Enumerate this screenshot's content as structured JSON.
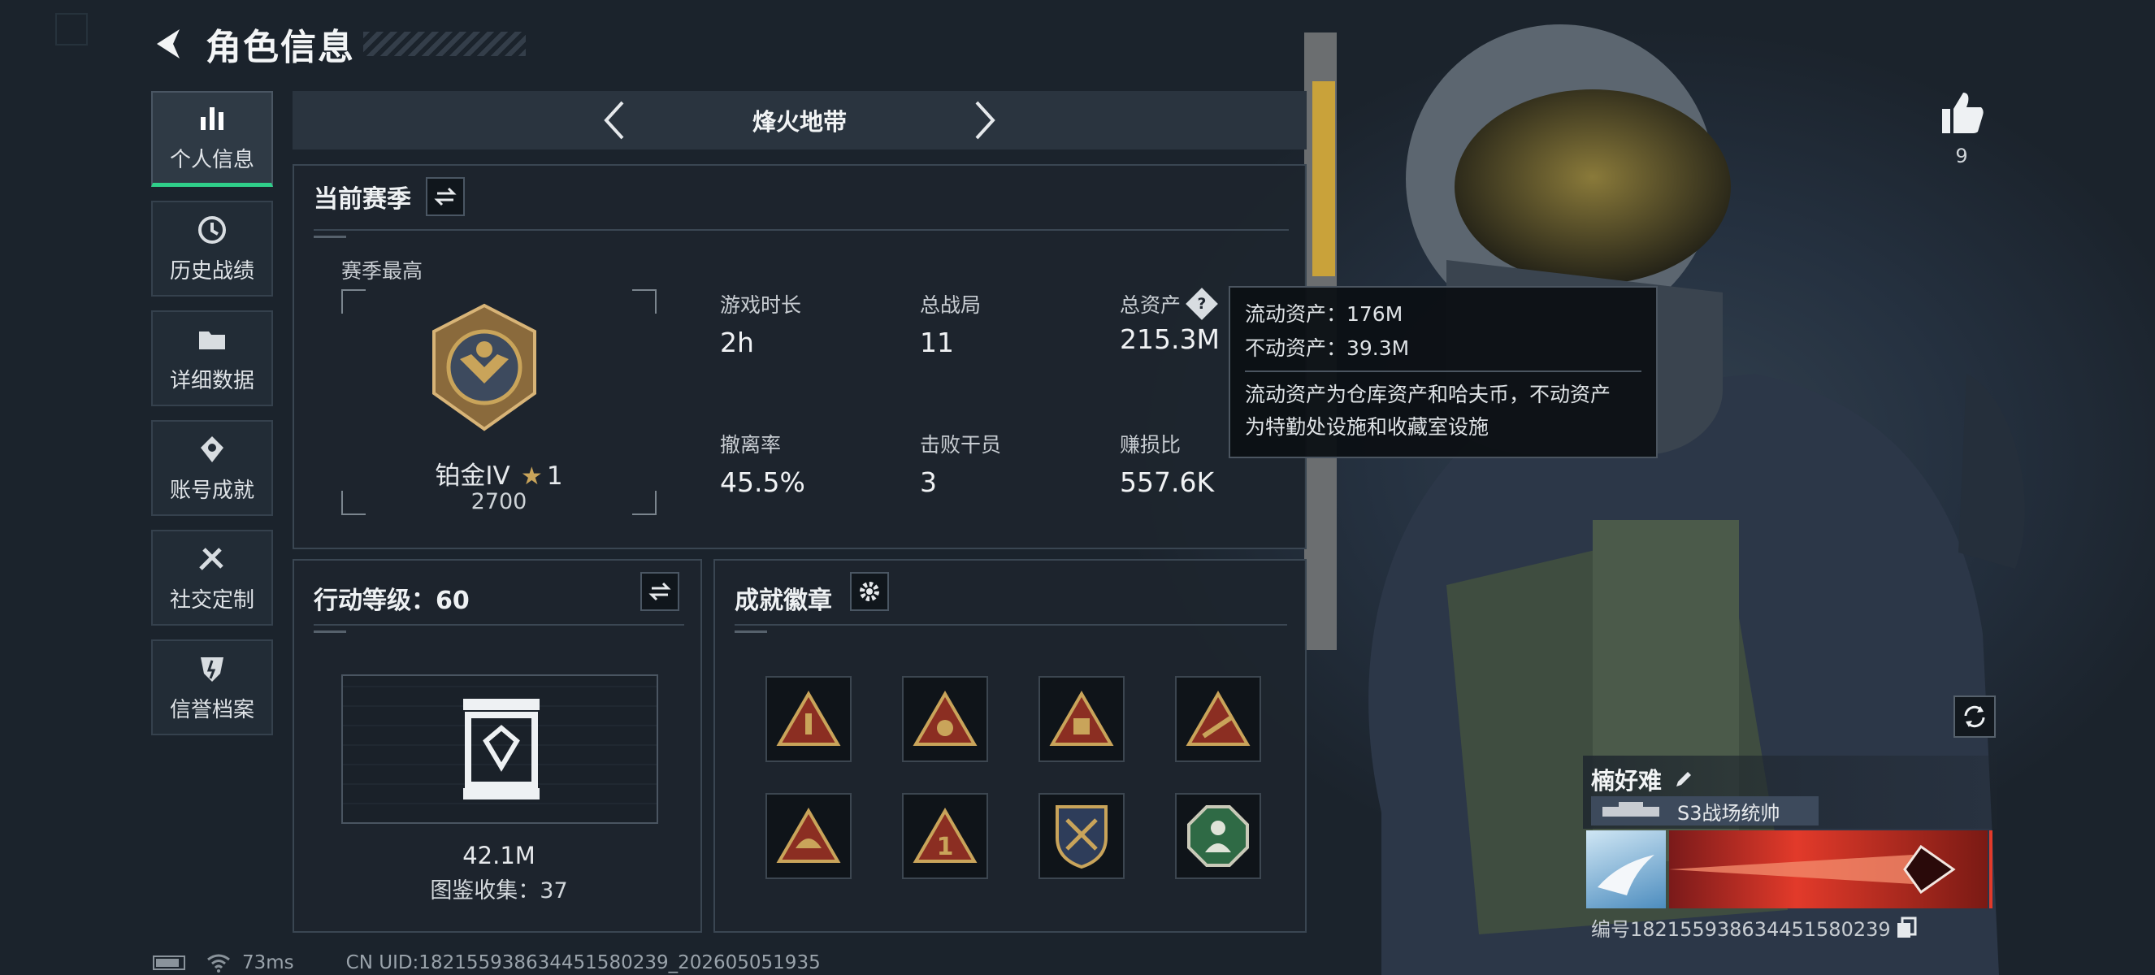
{
  "header": {
    "title": "角色信息"
  },
  "sidebar": {
    "items": [
      {
        "label": "个人信息",
        "icon": "bar-chart-icon"
      },
      {
        "label": "历史战绩",
        "icon": "history-icon"
      },
      {
        "label": "详细数据",
        "icon": "folder-icon"
      },
      {
        "label": "账号成就",
        "icon": "achievement-icon"
      },
      {
        "label": "社交定制",
        "icon": "tools-icon"
      },
      {
        "label": "信誉档案",
        "icon": "shield-icon"
      }
    ]
  },
  "mode": {
    "title": "烽火地带"
  },
  "season": {
    "heading": "当前赛季",
    "best_label": "赛季最高",
    "rank_name": "铂金IV",
    "rank_stars": "1",
    "rank_points": "2700",
    "stats": [
      {
        "label": "游戏时长",
        "value": "2h"
      },
      {
        "label": "总战局",
        "value": "11"
      },
      {
        "label": "总资产",
        "value": "215.3M"
      },
      {
        "label": "撤离率",
        "value": "45.5%"
      },
      {
        "label": "击败干员",
        "value": "3"
      },
      {
        "label": "赚损比",
        "value": "557.6K"
      }
    ]
  },
  "tooltip": {
    "liquid": "流动资产：176M",
    "fixed": "不动资产：39.3M",
    "desc1": "流动资产为仓库资产和哈夫币，不动资产",
    "desc2": "为特勤处设施和收藏室设施"
  },
  "action_level": {
    "heading": "行动等级：60",
    "value": "42.1M",
    "collection": "图鉴收集：37"
  },
  "badges": {
    "heading": "成就徽章"
  },
  "player": {
    "likes": "9",
    "name": "楠好难",
    "title_badge": "S3战场统帅",
    "id": "编号1821559386344515802​39"
  },
  "status": {
    "ping": "73ms",
    "uid": "CN UID:182155938634451580239_202605051935"
  },
  "colors": {
    "accent": "#2fcf8a",
    "gold": "#c9a45a",
    "panel": "#1d252e"
  }
}
